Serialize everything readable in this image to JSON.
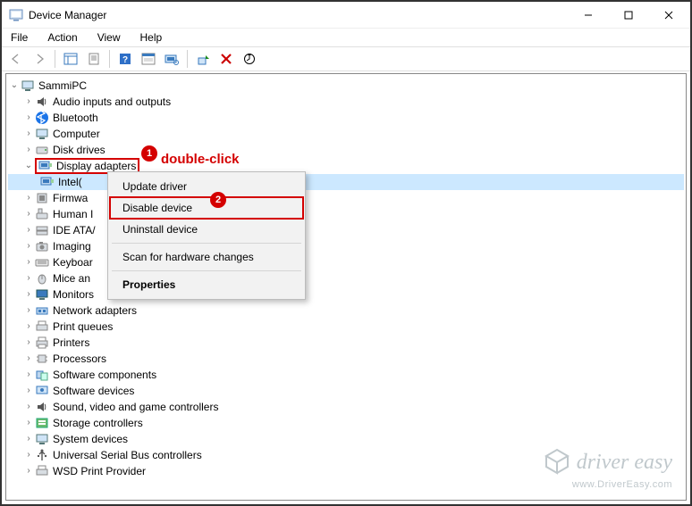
{
  "window": {
    "title": "Device Manager",
    "controls": {
      "minimize": "—",
      "maximize": "☐",
      "close": "✕"
    }
  },
  "menubar": [
    "File",
    "Action",
    "View",
    "Help"
  ],
  "toolbar": {
    "back": "back",
    "forward": "forward",
    "show_hidden": "show-hidden",
    "properties": "properties",
    "help": "help",
    "options": "options",
    "scan": "scan",
    "enable": "enable",
    "disable": "disable",
    "update": "update"
  },
  "tree": {
    "root": {
      "label": "SammiPC",
      "expanded": true
    },
    "nodes": [
      {
        "icon": "audio",
        "label": "Audio inputs and outputs",
        "expand": ">"
      },
      {
        "icon": "bluetooth",
        "label": "Bluetooth",
        "expand": ">"
      },
      {
        "icon": "computer",
        "label": "Computer",
        "expand": ">"
      },
      {
        "icon": "disk",
        "label": "Disk drives",
        "expand": ">"
      },
      {
        "icon": "display",
        "label": "Display adapters",
        "expand": "v",
        "highlight": true,
        "children": [
          {
            "icon": "display-chip",
            "label": "Intel(",
            "selected": true,
            "truncated": true
          }
        ]
      },
      {
        "icon": "firmware",
        "label": "Firmwa",
        "expand": ">",
        "truncated": true
      },
      {
        "icon": "hid",
        "label": "Human I",
        "expand": ">",
        "truncated": true
      },
      {
        "icon": "ide",
        "label": "IDE ATA/",
        "expand": ">",
        "truncated": true
      },
      {
        "icon": "imaging",
        "label": "Imaging",
        "expand": ">",
        "truncated": true
      },
      {
        "icon": "keyboard",
        "label": "Keyboar",
        "expand": ">",
        "truncated": true
      },
      {
        "icon": "mouse",
        "label": "Mice an",
        "expand": ">",
        "truncated": true
      },
      {
        "icon": "monitor",
        "label": "Monitors",
        "expand": ">"
      },
      {
        "icon": "network",
        "label": "Network adapters",
        "expand": ">"
      },
      {
        "icon": "printq",
        "label": "Print queues",
        "expand": ">"
      },
      {
        "icon": "printer",
        "label": "Printers",
        "expand": ">"
      },
      {
        "icon": "cpu",
        "label": "Processors",
        "expand": ">"
      },
      {
        "icon": "swcomp",
        "label": "Software components",
        "expand": ">"
      },
      {
        "icon": "swdev",
        "label": "Software devices",
        "expand": ">"
      },
      {
        "icon": "sound",
        "label": "Sound, video and game controllers",
        "expand": ">"
      },
      {
        "icon": "storage",
        "label": "Storage controllers",
        "expand": ">"
      },
      {
        "icon": "sysdev",
        "label": "System devices",
        "expand": ">"
      },
      {
        "icon": "usb",
        "label": "Universal Serial Bus controllers",
        "expand": ">"
      },
      {
        "icon": "wsd",
        "label": "WSD Print Provider",
        "expand": ">"
      }
    ]
  },
  "context_menu": {
    "items": [
      {
        "label": "Update driver"
      },
      {
        "label": "Disable device",
        "highlight": true
      },
      {
        "label": "Uninstall device"
      },
      {
        "sep": true
      },
      {
        "label": "Scan for hardware changes"
      },
      {
        "sep": true
      },
      {
        "label": "Properties",
        "bold": true
      }
    ]
  },
  "annotations": {
    "badge1": "1",
    "badge2": "2",
    "hint": "double-click"
  },
  "watermark": {
    "brand": "driver easy",
    "url": "www.DriverEasy.com"
  }
}
